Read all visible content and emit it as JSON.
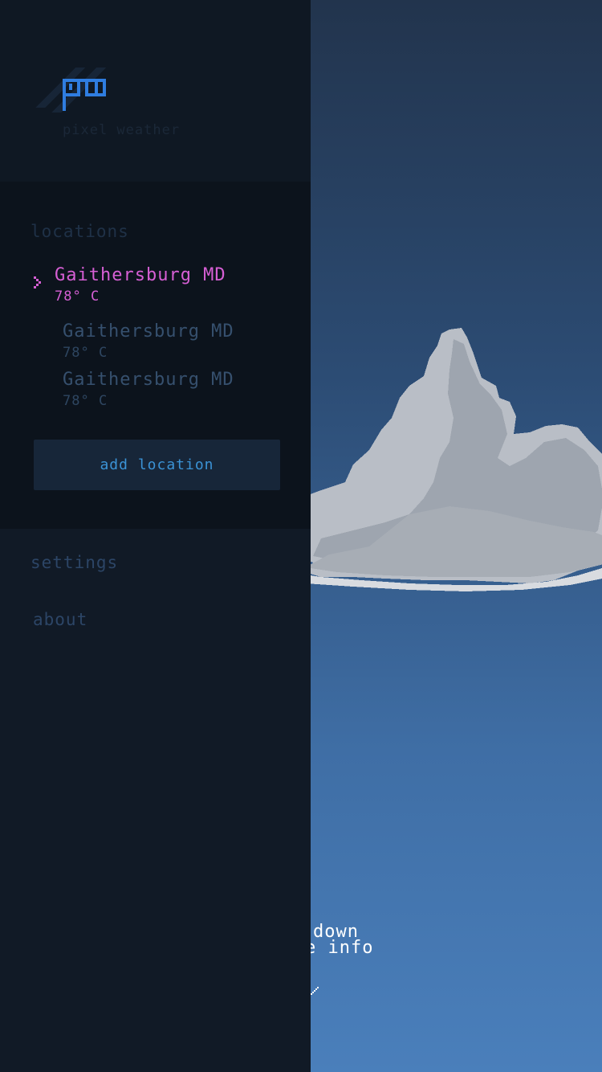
{
  "drawer": {
    "app_name": "pixel weather",
    "logo_icon": "pw-logo-icon",
    "locations_title": "locations",
    "locations": [
      {
        "name": "Gaithersburg MD",
        "temp": "78° C",
        "selected": true
      },
      {
        "name": "Gaithersburg MD",
        "temp": "78° C",
        "selected": false
      },
      {
        "name": "Gaithersburg MD",
        "temp": "78° C",
        "selected": false
      }
    ],
    "add_location_label": "add location",
    "menu": {
      "settings_label": "settings",
      "about_label": "about"
    }
  },
  "background": {
    "hint_line1": "down",
    "hint_line2": "e info"
  },
  "colors": {
    "accent_selected": "#d65fd4",
    "button_text": "#3b93d6",
    "drawer_bg": "#111a26"
  }
}
